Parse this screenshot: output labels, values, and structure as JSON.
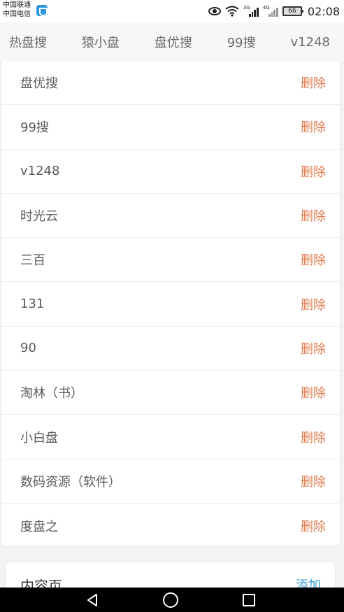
{
  "status": {
    "carrier_1": "中国联通",
    "carrier_2": "中国电信",
    "net_3g": "3G",
    "net_4g": "4G",
    "battery": "66",
    "time": "02:08"
  },
  "tabs": [
    "热盘搜",
    "猿小盘",
    "盘优搜",
    "99搜",
    "v1248"
  ],
  "rows": [
    {
      "name": "盘优搜",
      "action": "删除"
    },
    {
      "name": "99搜",
      "action": "删除"
    },
    {
      "name": "v1248",
      "action": "删除"
    },
    {
      "name": "时光云",
      "action": "删除"
    },
    {
      "name": "三百",
      "action": "删除"
    },
    {
      "name": "131",
      "action": "删除"
    },
    {
      "name": "90",
      "action": "删除"
    },
    {
      "name": "淘林（书）",
      "action": "删除"
    },
    {
      "name": "小白盘",
      "action": "删除"
    },
    {
      "name": "数码资源（软件）",
      "action": "删除"
    },
    {
      "name": "度盘之",
      "action": "删除"
    }
  ],
  "section": {
    "title": "内容页",
    "add": "添加"
  },
  "nav": {
    "icons": [
      "back-icon",
      "home-icon",
      "recents-icon"
    ]
  },
  "colors": {
    "delete": "#e0784a",
    "add": "#3aa0dc"
  }
}
